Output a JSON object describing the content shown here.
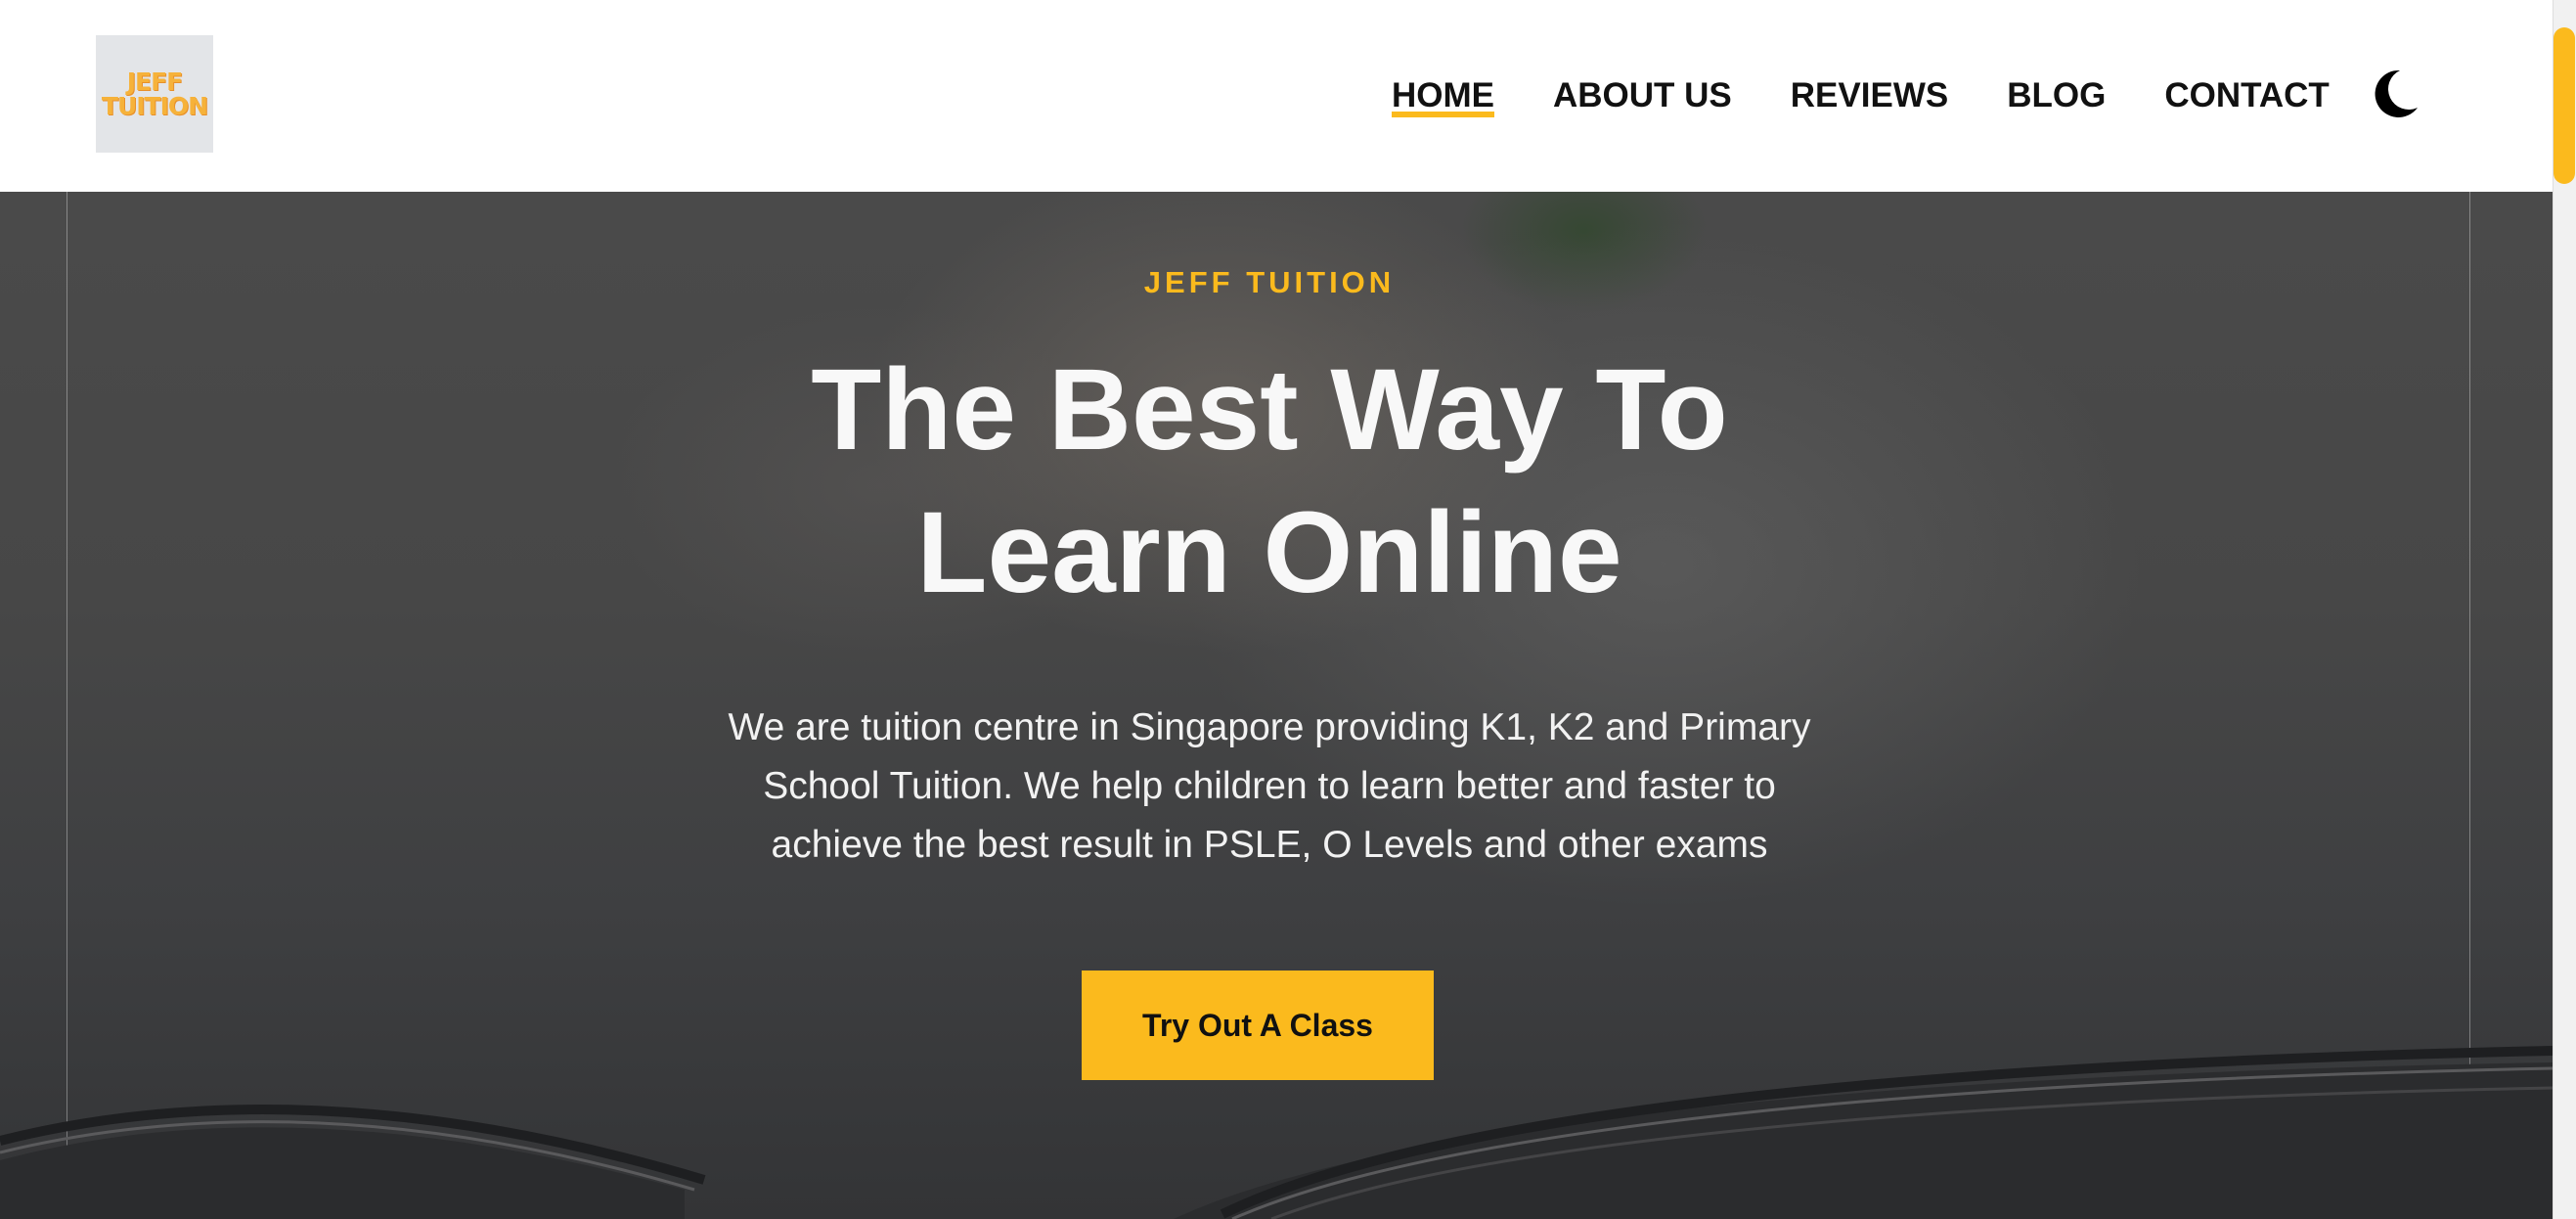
{
  "brand": {
    "logo_line1": "JEFF",
    "logo_line2": "TUITION"
  },
  "nav": {
    "items": [
      {
        "label": "HOME",
        "active": true
      },
      {
        "label": "ABOUT US",
        "active": false
      },
      {
        "label": "REVIEWS",
        "active": false
      },
      {
        "label": "BLOG",
        "active": false
      },
      {
        "label": "CONTACT",
        "active": false
      }
    ],
    "theme_toggle_icon": "moon-icon"
  },
  "hero": {
    "eyebrow": "JEFF TUITION",
    "title_line1": "The Best Way To",
    "title_line2": "Learn Online",
    "description": "We are tuition centre in Singapore providing K1, K2 and Primary School Tuition. We help children to learn better and faster to achieve the best result in PSLE, O Levels and other exams",
    "cta_label": "Try Out A Class"
  },
  "colors": {
    "accent": "#fbba1d",
    "text_dark": "#111111",
    "hero_overlay": "#474747"
  }
}
